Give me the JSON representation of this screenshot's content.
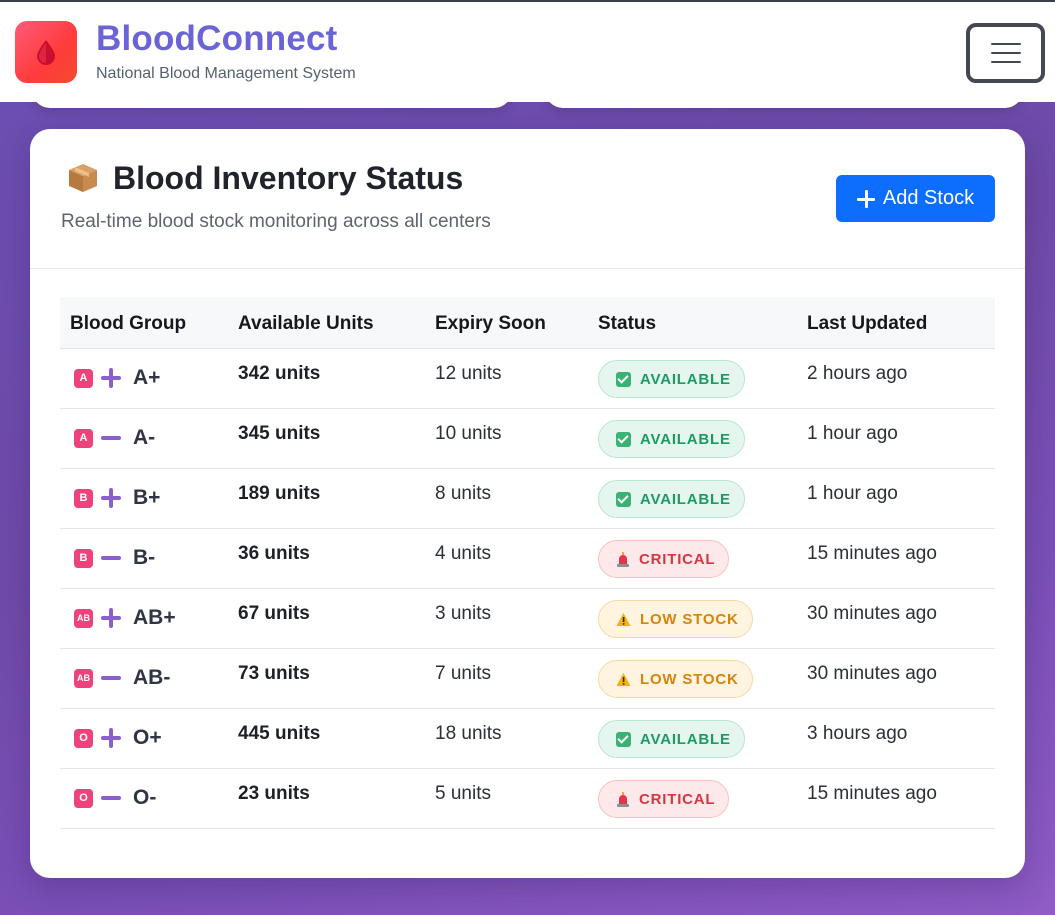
{
  "app": {
    "title": "BloodConnect",
    "subtitle": "National Blood Management System",
    "logo_icon": "blood-drop-icon",
    "menu_icon": "hamburger-menu-icon"
  },
  "inventory": {
    "title": "Blood Inventory Status",
    "title_icon": "package-box-icon",
    "subtitle": "Real-time blood stock monitoring across all centers",
    "add_button": "Add Stock",
    "columns": [
      "Blood Group",
      "Available Units",
      "Expiry Soon",
      "Status",
      "Last Updated"
    ],
    "rows": [
      {
        "letter": "A",
        "sign": "plus",
        "group": "A+",
        "units": "342 units",
        "expiry": "12 units",
        "status": "AVAILABLE",
        "status_type": "available",
        "updated": "2 hours ago"
      },
      {
        "letter": "A",
        "sign": "minus",
        "group": "A-",
        "units": "345 units",
        "expiry": "10 units",
        "status": "AVAILABLE",
        "status_type": "available",
        "updated": "1 hour ago"
      },
      {
        "letter": "B",
        "sign": "plus",
        "group": "B+",
        "units": "189 units",
        "expiry": "8 units",
        "status": "AVAILABLE",
        "status_type": "available",
        "updated": "1 hour ago"
      },
      {
        "letter": "B",
        "sign": "minus",
        "group": "B-",
        "units": "36 units",
        "expiry": "4 units",
        "status": "CRITICAL",
        "status_type": "critical",
        "updated": "15 minutes ago"
      },
      {
        "letter": "AB",
        "sign": "plus",
        "group": "AB+",
        "units": "67 units",
        "expiry": "3 units",
        "status": "LOW STOCK",
        "status_type": "low",
        "updated": "30 minutes ago"
      },
      {
        "letter": "AB",
        "sign": "minus",
        "group": "AB-",
        "units": "73 units",
        "expiry": "7 units",
        "status": "LOW STOCK",
        "status_type": "low",
        "updated": "30 minutes ago"
      },
      {
        "letter": "O",
        "sign": "plus",
        "group": "O+",
        "units": "445 units",
        "expiry": "18 units",
        "status": "AVAILABLE",
        "status_type": "available",
        "updated": "3 hours ago"
      },
      {
        "letter": "O",
        "sign": "minus",
        "group": "O-",
        "units": "23 units",
        "expiry": "5 units",
        "status": "CRITICAL",
        "status_type": "critical",
        "updated": "15 minutes ago"
      }
    ]
  },
  "colors": {
    "brand": "#6a64d6",
    "accent_button": "#0d6efd",
    "available": "#1c9a62",
    "critical": "#d63642",
    "low_stock": "#d6840b"
  }
}
